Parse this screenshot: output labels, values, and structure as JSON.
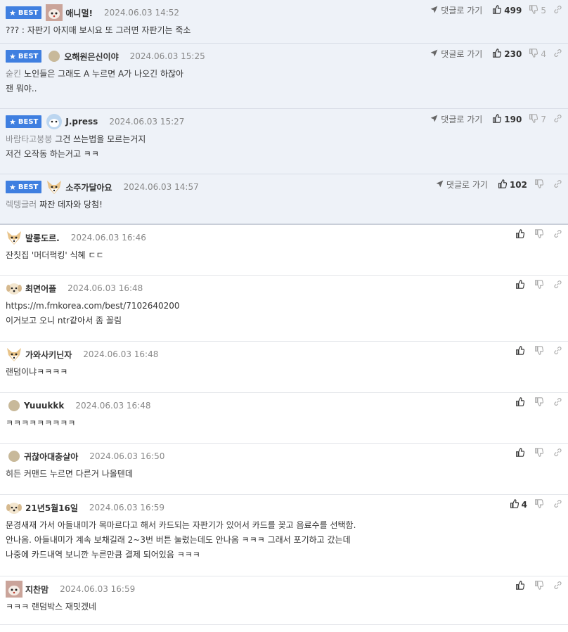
{
  "reply_label": "댓글로 가기",
  "best_label": "BEST",
  "comments": [
    {
      "best": true,
      "nick": "애니멀!",
      "date": "2024.06.03 14:52",
      "up": "499",
      "down": "5",
      "quote": "",
      "lines": [
        "??? : 자판기 아지매 보시요 또 그러면 자판기는 죽소"
      ],
      "avatar": "dog-face"
    },
    {
      "best": true,
      "nick": "오해원은신이야",
      "date": "2024.06.03 15:25",
      "up": "230",
      "down": "4",
      "quote": "숟킨",
      "lines": [
        "노인들은 그래도 A 누르면 A가 나오긴 하잖아",
        "잰 뭐야.."
      ],
      "avatar": "dot"
    },
    {
      "best": true,
      "nick": "J.press",
      "date": "2024.06.03 15:27",
      "up": "190",
      "down": "7",
      "quote": "바람타고붕붕",
      "lines": [
        "그건 쓰는법을 모르는거지",
        "저건 오작동 하는거고 ㅋㅋ"
      ],
      "avatar": "blue-dog"
    },
    {
      "best": true,
      "nick": "소주가달아요",
      "date": "2024.06.03 14:57",
      "up": "102",
      "down": "",
      "quote": "렉텡글러",
      "lines": [
        "짜잔 데자와 당첨!"
      ],
      "avatar": "fox"
    },
    {
      "best": false,
      "nick": "발롱도르.",
      "date": "2024.06.03 16:46",
      "up": "",
      "down": "",
      "quote": "",
      "lines": [
        "잔칫집 '머더퍽킹' 식혜 ㄷㄷ"
      ],
      "avatar": "fox"
    },
    {
      "best": false,
      "nick": "최면어플",
      "date": "2024.06.03 16:48",
      "up": "",
      "down": "",
      "quote": "",
      "lines": [
        "https://m.fmkorea.com/best/7102640200",
        "이거보고 오니 ntr같아서 좀 꼴림"
      ],
      "avatar": "puppy"
    },
    {
      "best": false,
      "nick": "가와사키닌자",
      "date": "2024.06.03 16:48",
      "up": "",
      "down": "",
      "quote": "",
      "lines": [
        "랜덤이냐ㅋㅋㅋㅋ"
      ],
      "avatar": "fox"
    },
    {
      "best": false,
      "nick": "Yuuukkk",
      "date": "2024.06.03 16:48",
      "up": "",
      "down": "",
      "quote": "",
      "lines": [
        "ㅋㅋㅋㅋㅋㅋㅋㅋㅋ"
      ],
      "avatar": "dot"
    },
    {
      "best": false,
      "nick": "귀찮아대충살아",
      "date": "2024.06.03 16:50",
      "up": "",
      "down": "",
      "quote": "",
      "lines": [
        "히든 커맨드 누르면 다른거 나올텐데"
      ],
      "avatar": "dot"
    },
    {
      "best": false,
      "nick": "21년5월16일",
      "date": "2024.06.03 16:59",
      "up": "4",
      "down": "",
      "quote": "",
      "lines": [
        "문경새재 가서 아들내미가 목마르다고 해서 카드되는 자판기가 있어서 카드를 꽂고 음료수를 선택함.",
        "안나옴. 아들내미가 계속 보채길래 2~3번 버튼 눌렀는데도 안나옴 ㅋㅋㅋ 그래서 포기하고 갔는데",
        "나중에 카드내역 보니깐 누른만큼 결제 되어있음 ㅋㅋㅋ"
      ],
      "avatar": "puppy"
    },
    {
      "best": false,
      "nick": "지찬맘",
      "date": "2024.06.03 16:59",
      "up": "",
      "down": "",
      "quote": "",
      "lines": [
        "ㅋㅋㅋ 랜덤박스 재밋겠네"
      ],
      "avatar": "dog-face"
    }
  ]
}
